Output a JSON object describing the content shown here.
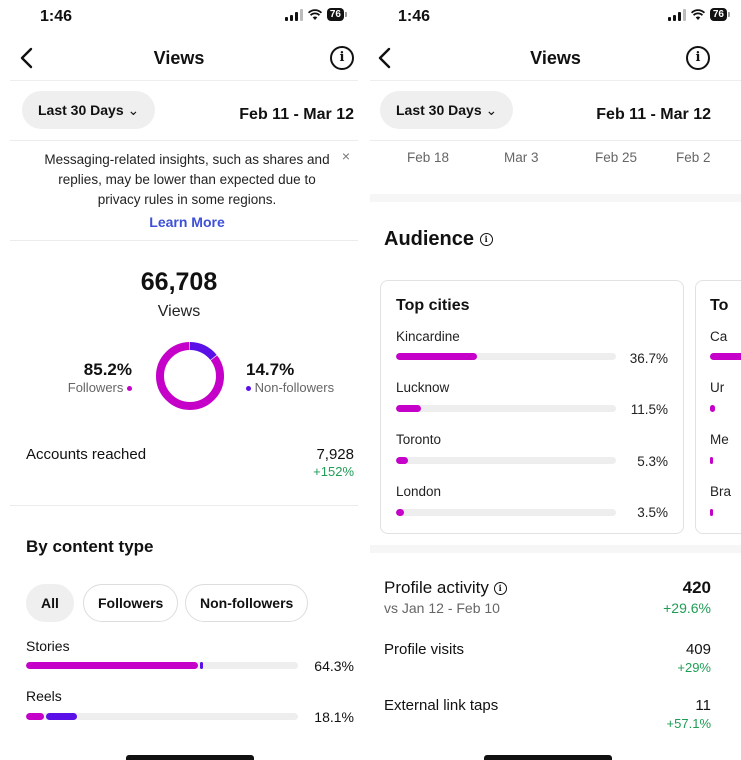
{
  "left": {
    "status": {
      "time": "1:46",
      "battery": "76"
    },
    "nav": {
      "title": "Views"
    },
    "range": {
      "label": "Last 30 Days",
      "dates": "Feb 11 - Mar 12"
    },
    "notice": {
      "text": "Messaging-related insights, such as shares and replies, may be lower than expected due to privacy rules in some regions.",
      "link": "Learn More",
      "close": "×"
    },
    "summary": {
      "total": "66,708",
      "label": "Views",
      "followers_pct": "85.2%",
      "followers_label": "Followers",
      "nonfollowers_pct": "14.7%",
      "nonfollowers_label": "Non-followers",
      "followers_share": 0.852,
      "nonfollowers_share": 0.147
    },
    "accounts": {
      "label": "Accounts reached",
      "value": "7,928",
      "change": "+152%"
    },
    "content_type": {
      "title": "By content type",
      "filters": [
        "All",
        "Followers",
        "Non-followers"
      ],
      "active_filter": "All",
      "rows": [
        {
          "label": "Stories",
          "pct": "64.3%",
          "followers_share": 0.632,
          "nonfollowers_share": 0.011
        },
        {
          "label": "Reels",
          "pct": "18.1%",
          "followers_share": 0.065,
          "nonfollowers_share": 0.116
        }
      ]
    }
  },
  "right": {
    "status": {
      "time": "1:46",
      "battery": "76"
    },
    "nav": {
      "title": "Views"
    },
    "range": {
      "label": "Last 30 Days",
      "dates": "Feb 11 - Mar 12"
    },
    "axis_labels": [
      "Feb 18",
      "Mar 3",
      "Feb 25",
      "Feb 2"
    ],
    "audience": {
      "title": "Audience",
      "top_cities": {
        "title": "Top cities",
        "rows": [
          {
            "name": "Kincardine",
            "pct": "36.7%",
            "share": 0.367
          },
          {
            "name": "Lucknow",
            "pct": "11.5%",
            "share": 0.115
          },
          {
            "name": "Toronto",
            "pct": "5.3%",
            "share": 0.053
          },
          {
            "name": "London",
            "pct": "3.5%",
            "share": 0.035
          }
        ]
      },
      "next_card": {
        "title": "To",
        "rows": [
          "Ca",
          "Ur",
          "Me",
          "Bra"
        ]
      }
    },
    "profile_activity": {
      "title": "Profile activity",
      "subtitle": "vs Jan 12 - Feb 10",
      "value": "420",
      "change": "+29.6%",
      "rows": [
        {
          "label": "Profile visits",
          "value": "409",
          "change": "+29%"
        },
        {
          "label": "External link taps",
          "value": "11",
          "change": "+57.1%"
        }
      ]
    }
  },
  "colors": {
    "followers": "#c400c9",
    "nonfollowers": "#5a10e6",
    "green": "#1f9d55",
    "link": "#3d50d8"
  }
}
